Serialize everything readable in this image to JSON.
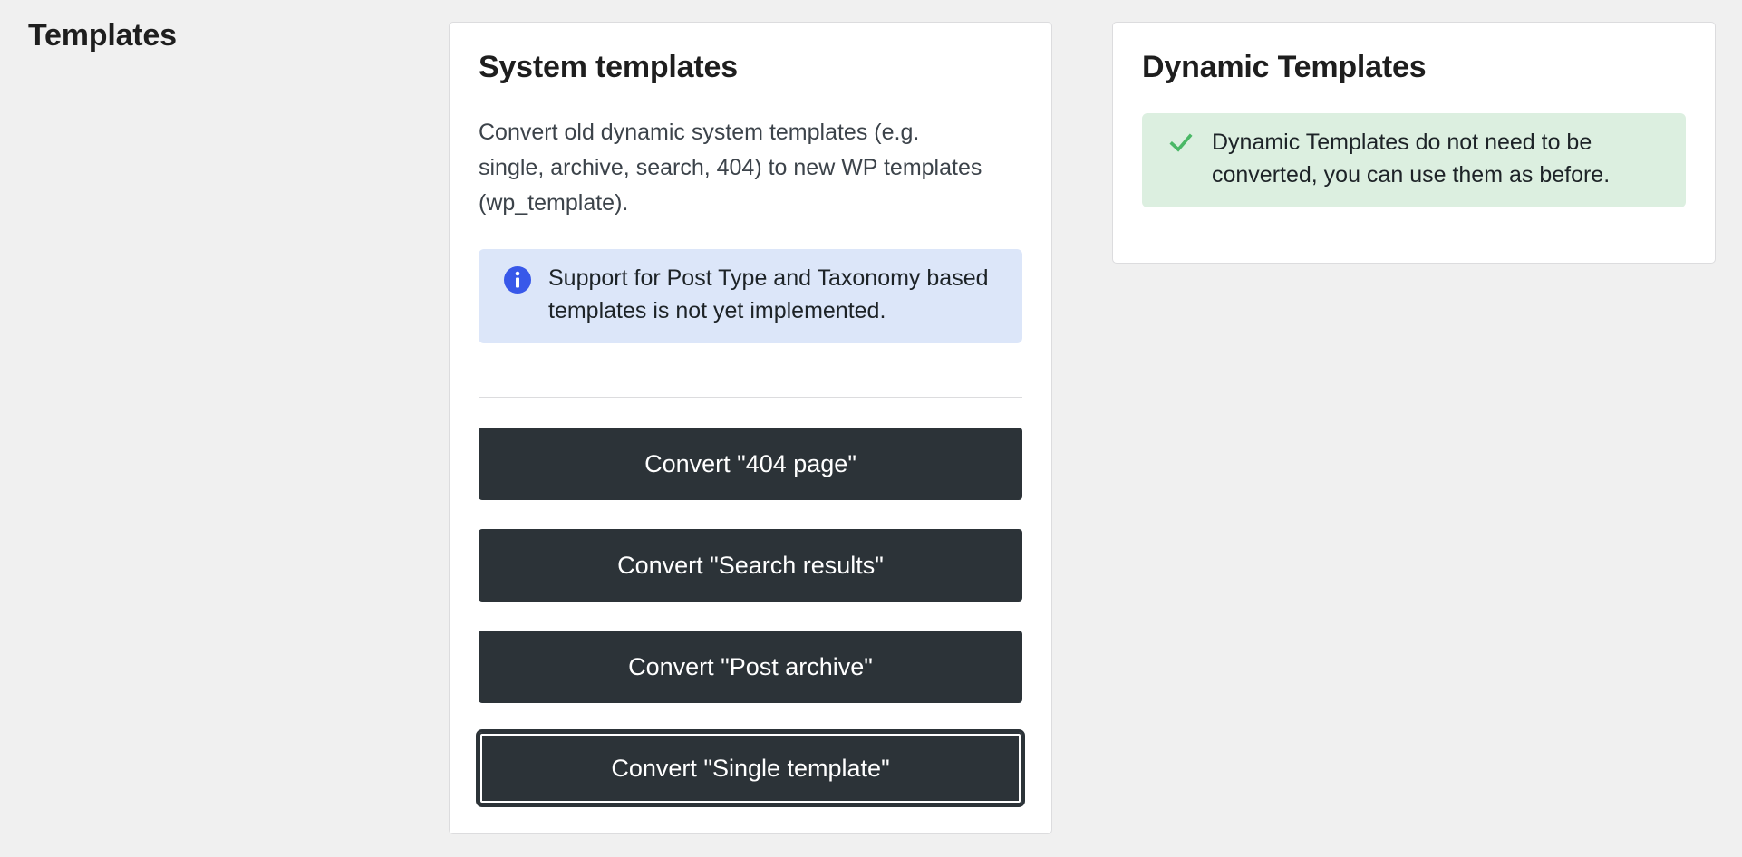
{
  "page": {
    "title": "Templates"
  },
  "system_templates": {
    "title": "System templates",
    "description": "Convert old dynamic system templates (e.g. single, archive, search, 404) to new WP templates (wp_template).",
    "info_notice": {
      "icon": "info-icon",
      "text": "Support for Post Type and Taxonomy based templates is not yet implemented."
    },
    "buttons": [
      {
        "label": "Convert \"404 page\""
      },
      {
        "label": "Convert \"Search results\""
      },
      {
        "label": "Convert \"Post archive\""
      },
      {
        "label": "Convert \"Single template\""
      }
    ]
  },
  "dynamic_templates": {
    "title": "Dynamic Templates",
    "success_notice": {
      "icon": "checkmark-icon",
      "text": "Dynamic Templates do not need to be converted, you can use them as before."
    }
  },
  "colors": {
    "background": "#f0f0f0",
    "button": "#2c3338",
    "info_bg": "#dce6f9",
    "info_icon": "#3858e9",
    "success_bg": "#dcefe0",
    "success_icon": "#4ab866"
  }
}
